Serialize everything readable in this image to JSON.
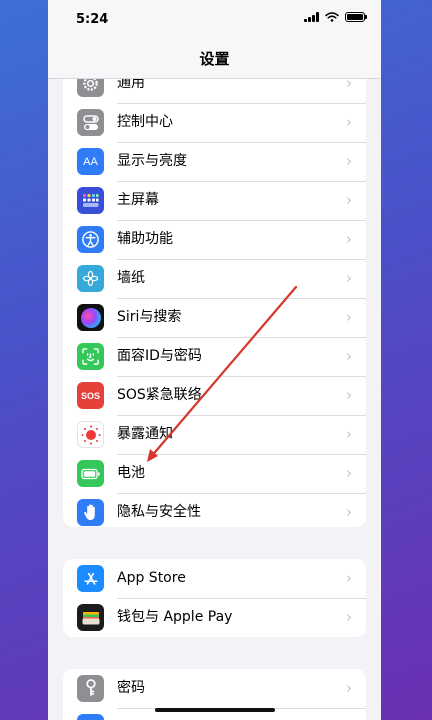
{
  "status": {
    "time": "5:24"
  },
  "nav": {
    "title": "设置"
  },
  "group1": {
    "items": [
      {
        "label": "通用",
        "icon": "gear-icon"
      },
      {
        "label": "控制中心",
        "icon": "control-center-icon"
      },
      {
        "label": "显示与亮度",
        "icon": "display-brightness-icon"
      },
      {
        "label": "主屏幕",
        "icon": "home-screen-icon"
      },
      {
        "label": "辅助功能",
        "icon": "accessibility-icon"
      },
      {
        "label": "墙纸",
        "icon": "wallpaper-icon"
      },
      {
        "label": "Siri与搜索",
        "icon": "siri-icon"
      },
      {
        "label": "面容ID与密码",
        "icon": "face-id-icon"
      },
      {
        "label": "SOS紧急联络",
        "icon": "sos-icon"
      },
      {
        "label": "暴露通知",
        "icon": "exposure-notification-icon"
      },
      {
        "label": "电池",
        "icon": "battery-icon"
      },
      {
        "label": "隐私与安全性",
        "icon": "privacy-hand-icon"
      }
    ]
  },
  "group2": {
    "items": [
      {
        "label": "App Store",
        "icon": "app-store-icon"
      },
      {
        "label": "钱包与 Apple Pay",
        "icon": "wallet-icon"
      }
    ]
  },
  "group3": {
    "items": [
      {
        "label": "密码",
        "icon": "key-icon"
      }
    ]
  },
  "icons": {
    "sos_text": "SOS",
    "aa_text": "AA"
  },
  "colors": {
    "accent_blue": "#2f7cf6",
    "annotation_arrow": "#d9342b"
  }
}
